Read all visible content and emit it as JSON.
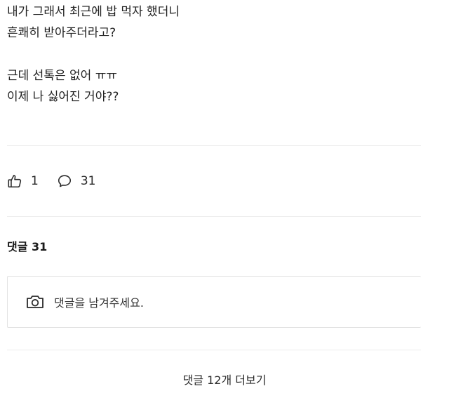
{
  "post": {
    "lines": [
      "내가 그래서 최근에 밥 먹자 했더니",
      "흔쾌히 받아주더라고?",
      "근데 선톡은 없어 ㅠㅠ",
      "이제 나 싫어진 거야??"
    ]
  },
  "reactions": {
    "like_icon": "thumbs-up-icon",
    "like_count": "1",
    "comment_icon": "speech-bubble-icon",
    "comment_count": "31"
  },
  "comments": {
    "heading": "댓글 31",
    "camera_icon": "camera-icon",
    "input_placeholder": "댓글을 남겨주세요.",
    "more_label": "댓글 12개 더보기"
  }
}
